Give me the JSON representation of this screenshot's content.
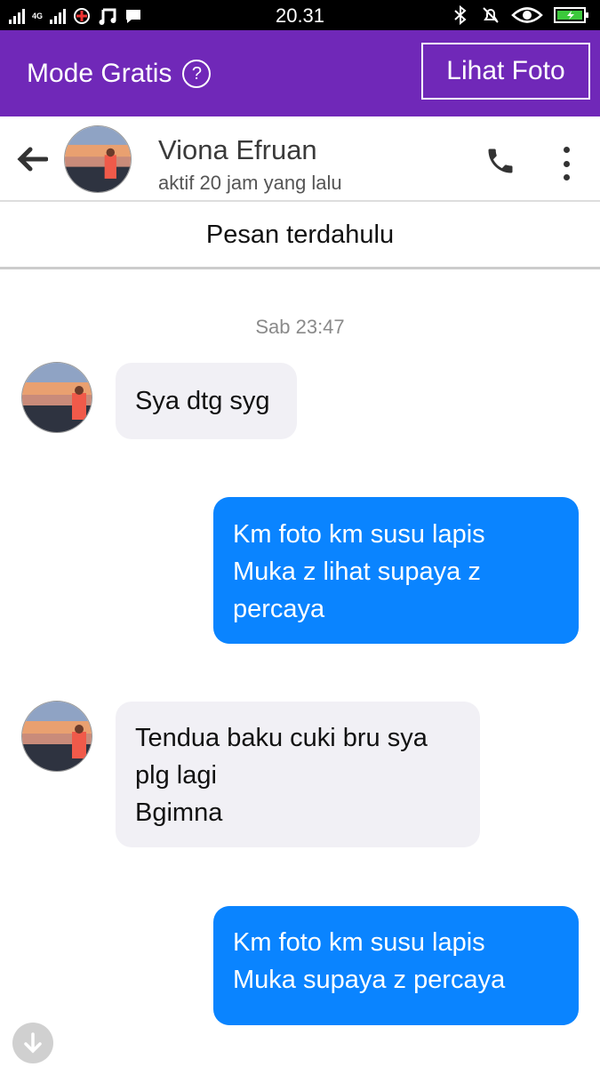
{
  "status_bar": {
    "time": "20.31",
    "network_label": "4G"
  },
  "promo": {
    "title": "Mode Gratis",
    "help_glyph": "?",
    "button_label": "Lihat Foto",
    "background": "#7028b8"
  },
  "chat_header": {
    "name": "Viona Efruan",
    "status": "aktif 20 jam yang lalu"
  },
  "earlier_label": "Pesan terdahulu",
  "timestamp": "Sab 23:47",
  "messages": [
    {
      "direction": "in",
      "text": "Sya dtg syg"
    },
    {
      "direction": "out",
      "text": "Km foto km susu lapis\nMuka z lihat supaya z\npercaya"
    },
    {
      "direction": "in",
      "text": "Tendua baku cuki bru sya\nplg lagi\nBgimna"
    },
    {
      "direction": "out",
      "text": "Km foto km susu lapis\nMuka supaya z percaya"
    }
  ],
  "colors": {
    "outgoing_bubble": "#0a84ff",
    "incoming_bubble": "#f1f0f5"
  },
  "icons": [
    "back-arrow-icon",
    "phone-icon",
    "more-vertical-icon",
    "help-icon",
    "scroll-down-icon"
  ]
}
